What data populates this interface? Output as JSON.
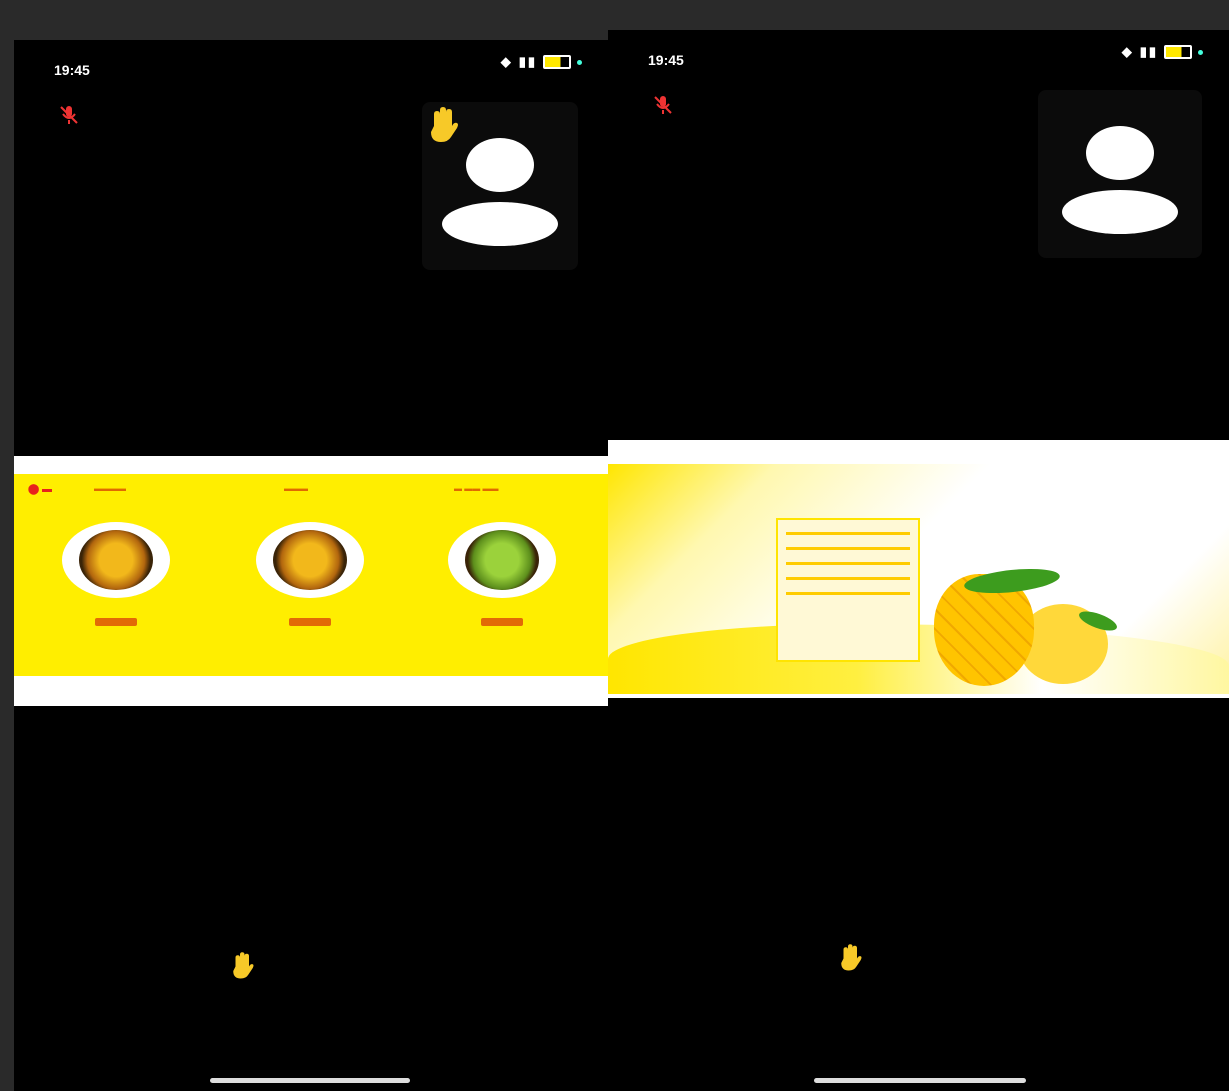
{
  "left_phone": {
    "status": {
      "time": "19:45"
    },
    "screen_share": {
      "products": [
        {
          "name": "",
          "button": ""
        },
        {
          "name": "",
          "button": ""
        },
        {
          "name": "",
          "button": ""
        }
      ]
    },
    "raised_hand": {
      "name": ""
    }
  },
  "right_phone": {
    "status": {
      "time": "19:45"
    },
    "screen_share": {
      "menu_title": ""
    },
    "raised_hand": {
      "name": ""
    }
  },
  "icons": {
    "mic": "mic-off-icon",
    "raised_hand": "raised-hand-icon",
    "avatar": "avatar-placeholder-icon",
    "wifi": "wifi-icon",
    "signal": "cell-signal-icon",
    "battery": "battery-icon"
  },
  "colors": {
    "background": "#000000",
    "share_yellow": "#ffee00",
    "accent_red": "#e8221c",
    "hand_yellow": "#f7c928"
  }
}
